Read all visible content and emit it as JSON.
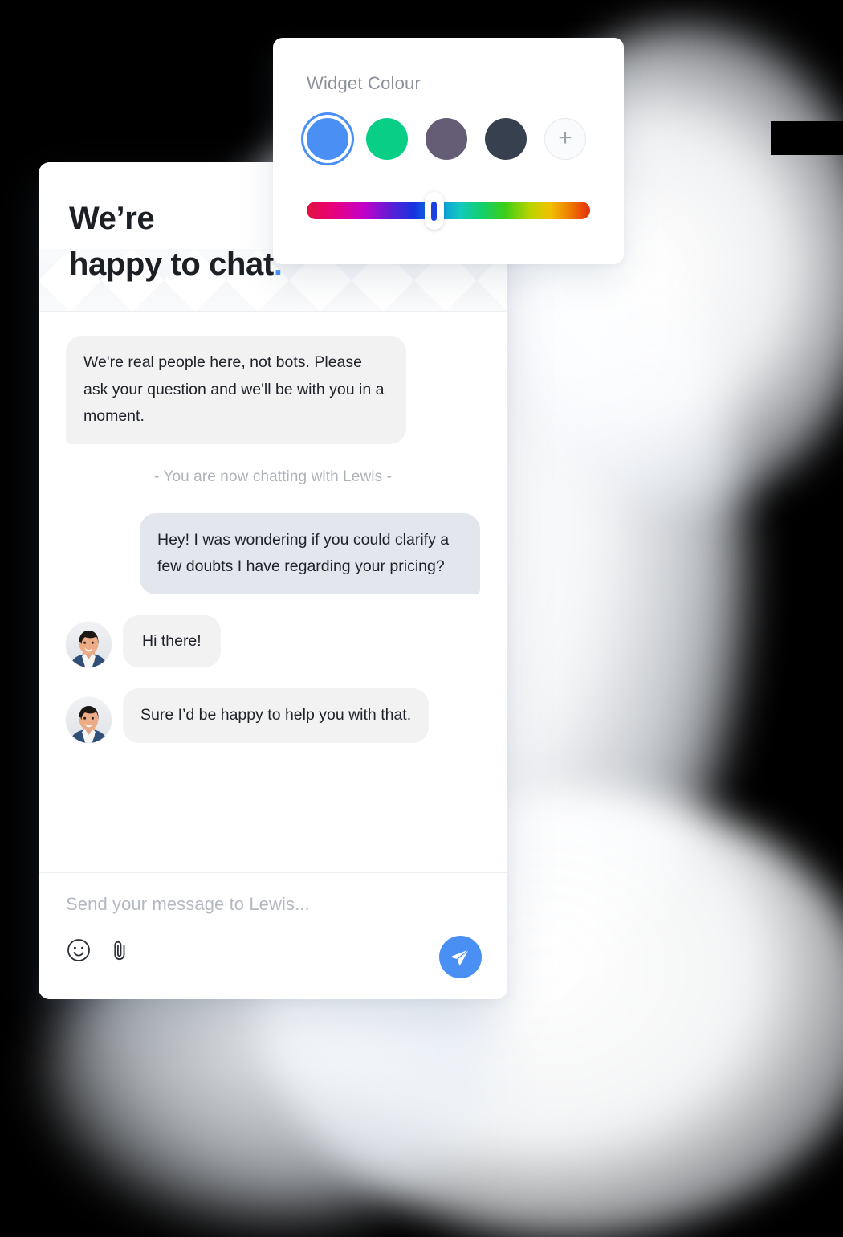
{
  "colour_card": {
    "title": "Widget Colour",
    "swatches": [
      {
        "name": "blue",
        "hex": "#4a90f4",
        "selected": true
      },
      {
        "name": "green",
        "hex": "#08ce86",
        "selected": false
      },
      {
        "name": "slate-purple",
        "hex": "#645d75",
        "selected": false
      },
      {
        "name": "dark-navy",
        "hex": "#37404e",
        "selected": false
      }
    ],
    "add_label": "+",
    "slider": {
      "name": "hue-slider",
      "thumb_position_percent": 45,
      "thumb_colour": "#1b41e0"
    }
  },
  "chat": {
    "header": {
      "line1": "We’re",
      "line2": "happy to chat",
      "accent_dot": "."
    },
    "messages": [
      {
        "id": "m1",
        "sender": "agent",
        "avatar": false,
        "tail": true,
        "text": "We're real people here, not bots. Please ask your question and we'll be with you in a moment."
      },
      {
        "id": "m2",
        "sender": "user",
        "avatar": false,
        "tail": true,
        "text": "Hey! I was wondering if you could clarify a few doubts I have regarding your pricing?"
      },
      {
        "id": "m3",
        "sender": "agent",
        "avatar": true,
        "tail": false,
        "text": "Hi there!"
      },
      {
        "id": "m4",
        "sender": "agent",
        "avatar": true,
        "tail": false,
        "text": "Sure I’d be happy to help you with that."
      }
    ],
    "system_note": "- You are now chatting with Lewis -",
    "composer": {
      "placeholder": "Send your message to Lewis...",
      "value": "",
      "emoji_icon": "smiley-icon",
      "attach_icon": "paperclip-icon",
      "send_icon": "paper-plane-icon",
      "send_button_colour": "#4a90f4"
    }
  },
  "agent_name": "Lewis"
}
